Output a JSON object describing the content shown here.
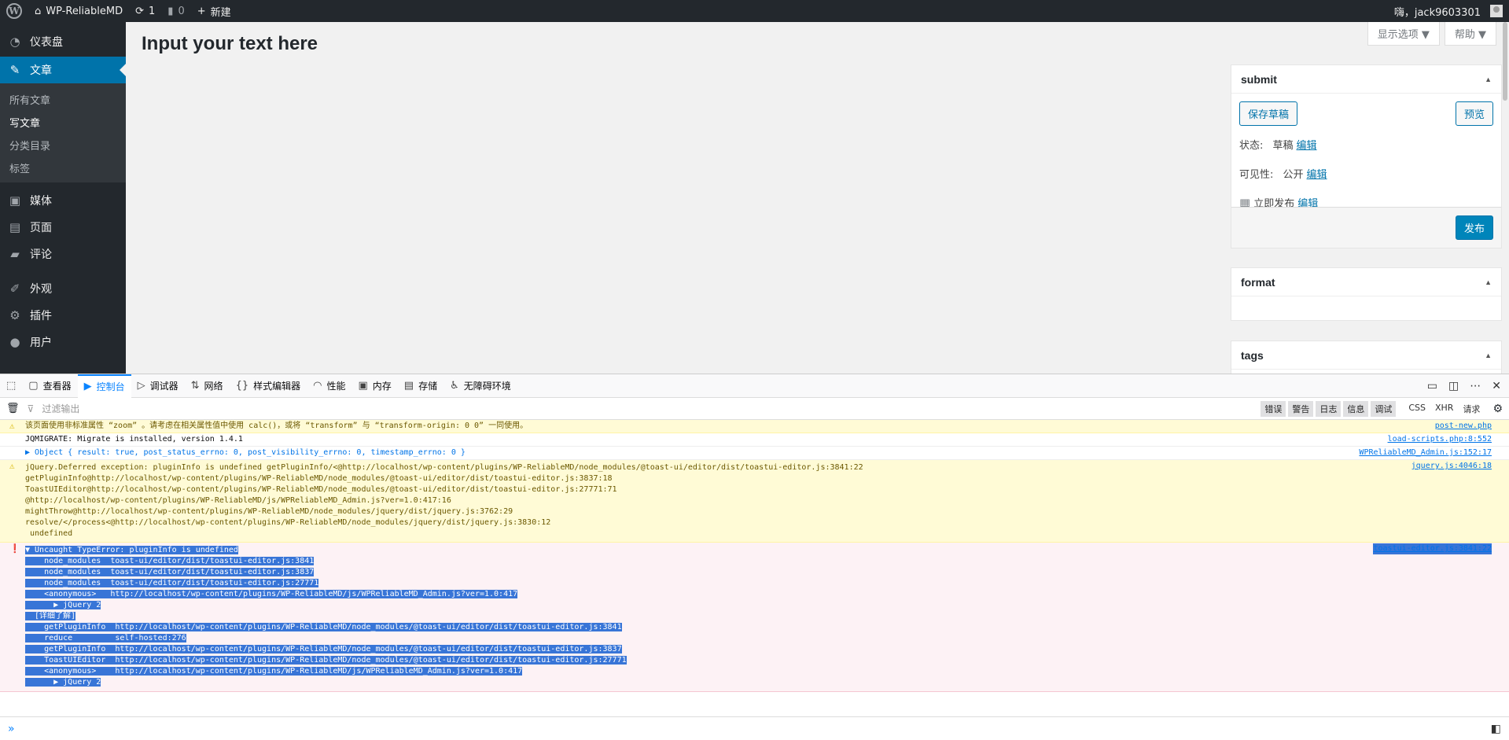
{
  "adminbar": {
    "site_name": "WP-ReliableMD",
    "updates_count": "1",
    "comments_count": "0",
    "new_label": "新建",
    "greeting": "嗨，jack9603301"
  },
  "sidebar": {
    "items": [
      {
        "label": "仪表盘",
        "icon": "dashboard-icon"
      },
      {
        "label": "文章",
        "icon": "pin-icon",
        "current": true
      },
      {
        "label": "媒体",
        "icon": "media-icon"
      },
      {
        "label": "页面",
        "icon": "page-icon"
      },
      {
        "label": "评论",
        "icon": "comment-icon"
      },
      {
        "label": "外观",
        "icon": "brush-icon"
      },
      {
        "label": "插件",
        "icon": "plugin-icon"
      },
      {
        "label": "用户",
        "icon": "user-icon"
      }
    ],
    "submenu": [
      "所有文章",
      "写文章",
      "分类目录",
      "标签"
    ]
  },
  "main": {
    "title": "Input your text here",
    "screen_options": "显示选项 ▼",
    "help": "帮助 ▼"
  },
  "submitbox": {
    "title": "submit",
    "save_draft": "保存草稿",
    "preview": "预览",
    "status_label": "状态:",
    "status_value": "草稿",
    "visibility_label": "可见性:",
    "visibility_value": "公开",
    "publish_label": "立即发布",
    "edit": "编辑",
    "publish_button": "发布"
  },
  "formatbox": {
    "title": "format"
  },
  "tagsbox": {
    "title": "tags"
  },
  "devtools": {
    "tabs": [
      "查看器",
      "控制台",
      "调试器",
      "网络",
      "样式编辑器",
      "性能",
      "内存",
      "存储",
      "无障碍环境"
    ],
    "filter_placeholder": "过滤输出",
    "filters": [
      "错误",
      "警告",
      "日志",
      "信息",
      "调试"
    ],
    "filters2": [
      "CSS",
      "XHR",
      "请求"
    ],
    "messages": [
      {
        "type": "warn",
        "text": "该页面使用非标准属性 “zoom” 。请考虑在相关属性值中使用 calc()，或将 “transform” 与 “transform-origin: 0 0” 一同使用。",
        "src": "post-new.php"
      },
      {
        "type": "log",
        "text": "JQMIGRATE: Migrate is installed, version 1.4.1",
        "src": "load-scripts.php:8:552"
      },
      {
        "type": "obj",
        "text": "▶ Object { result: true, post_status_errno: 0, post_visibility_errno: 0, timestamp_errno: 0 }",
        "src": "WPReliableMD_Admin.js:152:17"
      },
      {
        "type": "warn",
        "text": "jQuery.Deferred exception: pluginInfo is undefined getPluginInfo/<@http://localhost/wp-content/plugins/WP-ReliableMD/node_modules/@toast-ui/editor/dist/toastui-editor.js:3841:22\ngetPluginInfo@http://localhost/wp-content/plugins/WP-ReliableMD/node_modules/@toast-ui/editor/dist/toastui-editor.js:3837:18\nToastUIEditor@http://localhost/wp-content/plugins/WP-ReliableMD/node_modules/@toast-ui/editor/dist/toastui-editor.js:27771:71\n@http://localhost/wp-content/plugins/WP-ReliableMD/js/WPReliableMD_Admin.js?ver=1.0:417:16\nmightThrow@http://localhost/wp-content/plugins/WP-ReliableMD/node_modules/jquery/dist/jquery.js:3762:29\nresolve/</process<@http://localhost/wp-content/plugins/WP-ReliableMD/node_modules/jquery/dist/jquery.js:3830:12\n undefined",
        "src": "jquery.js:4046:18"
      },
      {
        "type": "err",
        "text": "▼ Uncaught TypeError: pluginInfo is undefined\n    node_modules  toast-ui/editor/dist/toastui-editor.js:3841\n    node_modules  toast-ui/editor/dist/toastui-editor.js:3837\n    node_modules  toast-ui/editor/dist/toastui-editor.js:27771\n    <anonymous>   http://localhost/wp-content/plugins/WP-ReliableMD/js/WPReliableMD_Admin.js?ver=1.0:417\n      ▶ jQuery 2\n  [详细了解]\n    getPluginInfo  http://localhost/wp-content/plugins/WP-ReliableMD/node_modules/@toast-ui/editor/dist/toastui-editor.js:3841\n    reduce         self-hosted:276\n    getPluginInfo  http://localhost/wp-content/plugins/WP-ReliableMD/node_modules/@toast-ui/editor/dist/toastui-editor.js:3837\n    ToastUIEditor  http://localhost/wp-content/plugins/WP-ReliableMD/node_modules/@toast-ui/editor/dist/toastui-editor.js:27771\n    <anonymous>    http://localhost/wp-content/plugins/WP-ReliableMD/js/WPReliableMD_Admin.js?ver=1.0:417\n      ▶ jQuery 2",
        "src": "toastui-editor.js:3841:22"
      }
    ],
    "prompt": "»"
  }
}
